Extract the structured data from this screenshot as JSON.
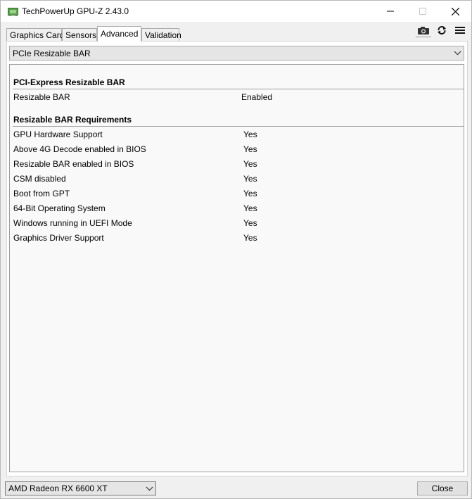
{
  "window": {
    "title": "TechPowerUp GPU-Z 2.43.0"
  },
  "tabs": [
    {
      "label": "Graphics Card"
    },
    {
      "label": "Sensors"
    },
    {
      "label": "Advanced",
      "active": true
    },
    {
      "label": "Validation"
    }
  ],
  "toolbar": {
    "icons": [
      "camera-icon",
      "refresh-icon",
      "menu-icon"
    ]
  },
  "advanced": {
    "dropdown_value": "PCIe Resizable BAR",
    "sections": [
      {
        "title": "PCI-Express Resizable BAR",
        "rows": [
          {
            "label": "Resizable BAR",
            "value": "Enabled"
          }
        ]
      },
      {
        "title": "Resizable BAR Requirements",
        "rows": [
          {
            "label": "GPU Hardware Support",
            "value": "Yes"
          },
          {
            "label": "Above 4G Decode enabled in BIOS",
            "value": "Yes"
          },
          {
            "label": "Resizable BAR enabled in BIOS",
            "value": "Yes"
          },
          {
            "label": "CSM disabled",
            "value": "Yes"
          },
          {
            "label": "Boot from GPT",
            "value": "Yes"
          },
          {
            "label": "64-Bit Operating System",
            "value": "Yes"
          },
          {
            "label": "Windows running in UEFI Mode",
            "value": "Yes"
          },
          {
            "label": "Graphics Driver Support",
            "value": "Yes"
          }
        ]
      }
    ]
  },
  "footer": {
    "gpu_select_value": "AMD Radeon RX 6600 XT",
    "close_label": "Close"
  },
  "colors": {
    "title_bar": "#ffffff",
    "window_bg": "#f0f0f0",
    "content_bg": "#f9f9f9",
    "app_icon_green": "#4caf50"
  }
}
